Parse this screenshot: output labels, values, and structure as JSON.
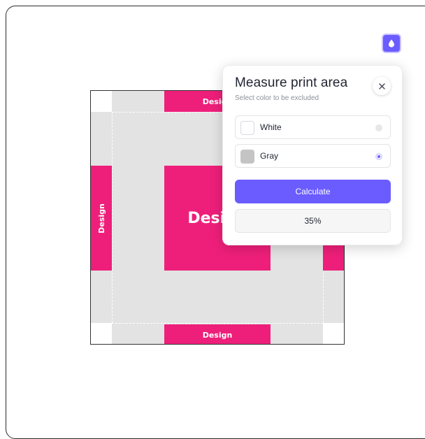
{
  "tool": {
    "icon": "droplet-icon"
  },
  "canvas": {
    "labels": {
      "top": "Design",
      "left": "Design",
      "center": "Design",
      "bottom": "Design"
    }
  },
  "panel": {
    "title": "Measure print area",
    "subtitle": "Select color to be excluded",
    "close_icon": "close-icon",
    "options": [
      {
        "label": "White",
        "swatch_color": "#ffffff",
        "selected": false
      },
      {
        "label": "Gray",
        "swatch_color": "#c4c4c4",
        "selected": true
      }
    ],
    "calculate_label": "Calculate",
    "result": "35%"
  },
  "colors": {
    "accent": "#6a5cff",
    "design_pink": "#ee1f7a",
    "background_gray": "#e3e3e3"
  }
}
